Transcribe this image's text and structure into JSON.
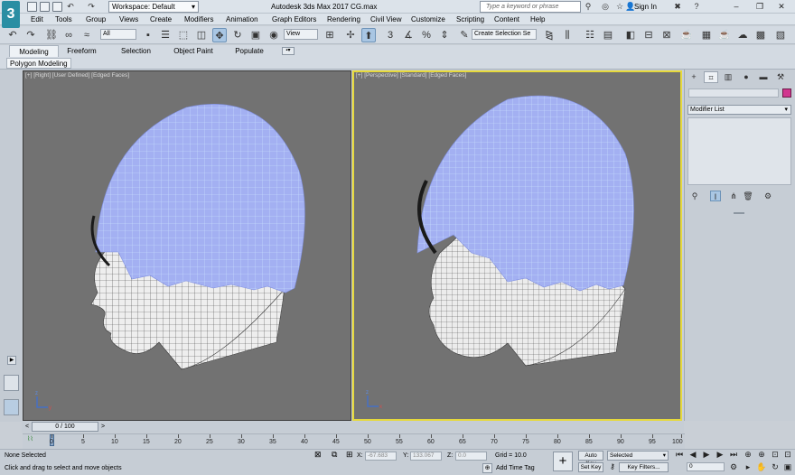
{
  "app": {
    "logo": "3",
    "workspace": "Workspace: Default",
    "title": "Autodesk 3ds Max 2017     CG.max",
    "search_placeholder": "Type a keyword or phrase",
    "signin": "Sign In"
  },
  "menu": [
    "Edit",
    "Tools",
    "Group",
    "Views",
    "Create",
    "Modifiers",
    "Animation",
    "Graph Editors",
    "Rendering",
    "Civil View",
    "Customize",
    "Scripting",
    "Content",
    "Help"
  ],
  "toolbar": {
    "filter": "All",
    "refcoord": "View",
    "selection_set": "Create Selection Se"
  },
  "ribbon": {
    "tabs": [
      "Modeling",
      "Freeform",
      "Selection",
      "Object Paint",
      "Populate"
    ],
    "panel_label": "Polygon Modeling"
  },
  "viewports": {
    "left_label": "[+] [Right] [User Defined] [Edged Faces]",
    "right_label": "[+] [Perspective] [Standard] [Edged Faces]"
  },
  "command_panel": {
    "modifier_list": "Modifier List"
  },
  "timeline": {
    "slider": "0 / 100",
    "ticks": [
      "0",
      "5",
      "10",
      "15",
      "20",
      "25",
      "30",
      "35",
      "40",
      "45",
      "50",
      "55",
      "60",
      "65",
      "70",
      "75",
      "80",
      "85",
      "90",
      "95",
      "100"
    ]
  },
  "status": {
    "selection": "None Selected",
    "prompt": "Click and drag to select and move objects",
    "x_label": "X:",
    "x_value": "-67.683",
    "y_label": "Y:",
    "y_value": "133.067",
    "z_label": "Z:",
    "z_value": "0.0",
    "grid": "Grid = 10.0",
    "add_time_tag": "Add Time Tag",
    "auto_key": "Auto Key",
    "set_key": "Set Key",
    "selected": "Selected",
    "key_filters": "Key Filters...",
    "frame": "0"
  }
}
